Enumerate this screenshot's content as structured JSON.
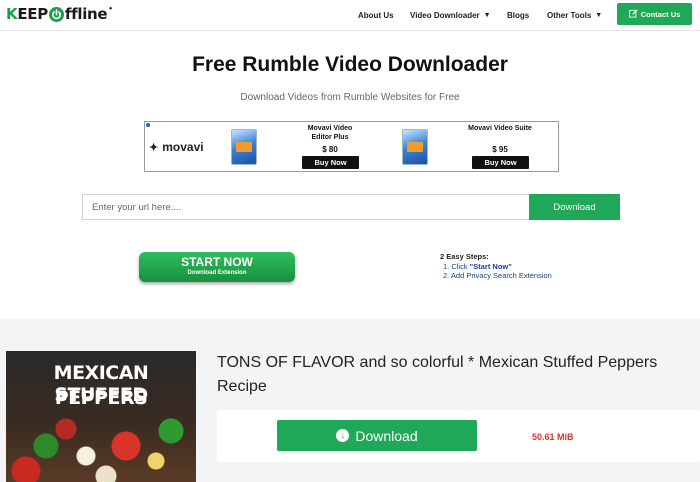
{
  "header": {
    "logo_prefix": "K",
    "logo_mid": "EEP",
    "logo_o": "O",
    "logo_suffix": "ffline",
    "logo_mark": "•",
    "nav": [
      {
        "label": "About Us"
      },
      {
        "label": "Video Downloader",
        "dropdown": true
      },
      {
        "label": "Blogs"
      },
      {
        "label": "Other Tools",
        "dropdown": true
      }
    ],
    "contact_label": "Contact Us",
    "contact_icon": "edit-icon"
  },
  "hero": {
    "title": "Free Rumble Video Downloader",
    "subtitle": "Download Videos from Rumble Websites for Free"
  },
  "ad": {
    "brand": "movavi",
    "products": [
      {
        "name": "Movavi Video Editor Plus",
        "price": "$ 80",
        "button": "Buy Now"
      },
      {
        "name": "Movavi Video Suite",
        "price": "$ 95",
        "button": "Buy Now"
      }
    ]
  },
  "search": {
    "placeholder": "Enter your url here....",
    "button": "Download"
  },
  "extension": {
    "start_label": "START NOW",
    "start_sub": "Download Extension",
    "steps_head": "2 Easy Steps:",
    "step1_prefix": "1. Click ",
    "step1_link": "\"Start Now\"",
    "step2": "2. Add Privacy Search Extension"
  },
  "video": {
    "thumb_line1": "MEXICAN STUFFED",
    "thumb_line2": "PEPPERS",
    "title": "TONS OF FLAVOR and so colorful * Mexican Stuffed Peppers Recipe",
    "download_label": "Download",
    "file_size": "50.61 MiB"
  },
  "colors": {
    "accent": "#1ea857",
    "size_text": "#e0322b"
  }
}
